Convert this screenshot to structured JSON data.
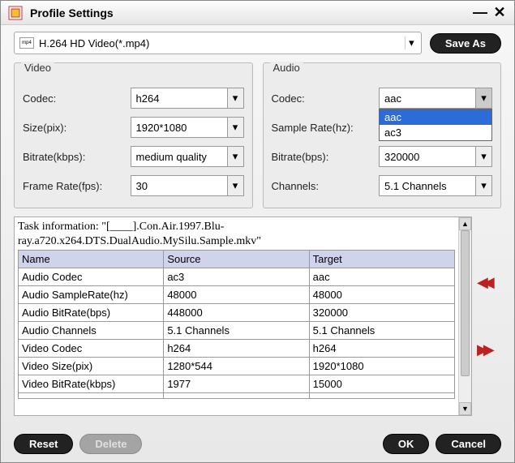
{
  "window": {
    "title": "Profile Settings"
  },
  "profile": {
    "selected": "H.264 HD Video(*.mp4)",
    "save_as_label": "Save As"
  },
  "video": {
    "group_title": "Video",
    "codec_label": "Codec:",
    "codec_value": "h264",
    "size_label": "Size(pix):",
    "size_value": "1920*1080",
    "bitrate_label": "Bitrate(kbps):",
    "bitrate_value": "medium quality",
    "fps_label": "Frame Rate(fps):",
    "fps_value": "30"
  },
  "audio": {
    "group_title": "Audio",
    "codec_label": "Codec:",
    "codec_value": "aac",
    "codec_options": {
      "opt0": "aac",
      "opt1": "ac3"
    },
    "sr_label": "Sample Rate(hz):",
    "bitrate_label": "Bitrate(bps):",
    "bitrate_value": "320000",
    "channels_label": "Channels:",
    "channels_value": "5.1 Channels"
  },
  "info": {
    "task_line1": "Task information: \"[____].Con.Air.1997.Blu-",
    "task_line2": "ray.a720.x264.DTS.DualAudio.MySilu.Sample.mkv\"",
    "headers": {
      "name": "Name",
      "source": "Source",
      "target": "Target"
    },
    "rows": {
      "r0": {
        "name": "Audio Codec",
        "source": "ac3",
        "target": "aac"
      },
      "r1": {
        "name": "Audio SampleRate(hz)",
        "source": "48000",
        "target": "48000"
      },
      "r2": {
        "name": "Audio BitRate(bps)",
        "source": "448000",
        "target": "320000"
      },
      "r3": {
        "name": "Audio Channels",
        "source": "5.1 Channels",
        "target": "5.1 Channels"
      },
      "r4": {
        "name": "Video Codec",
        "source": "h264",
        "target": "h264"
      },
      "r5": {
        "name": "Video Size(pix)",
        "source": "1280*544",
        "target": "1920*1080"
      },
      "r6": {
        "name": "Video BitRate(kbps)",
        "source": "1977",
        "target": "15000"
      }
    }
  },
  "footer": {
    "reset": "Reset",
    "delete": "Delete",
    "ok": "OK",
    "cancel": "Cancel"
  }
}
